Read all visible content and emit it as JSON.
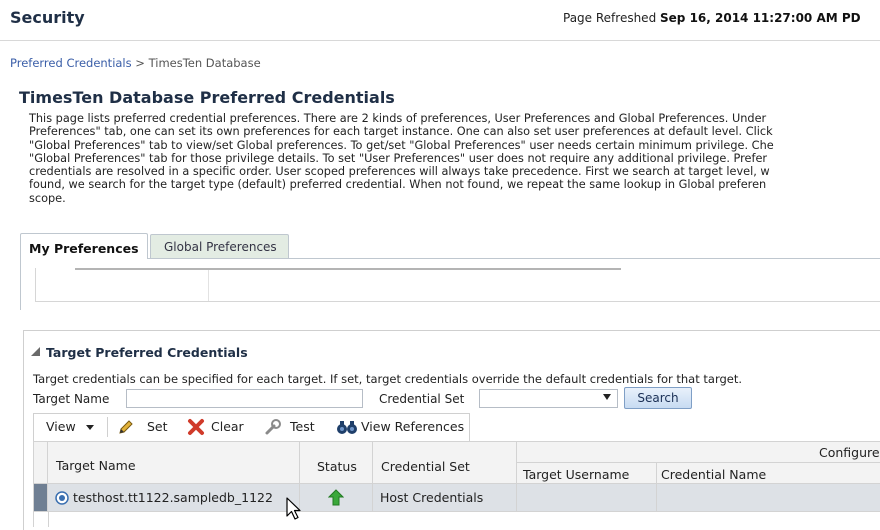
{
  "header": {
    "title": "Security",
    "refresh_prefix": "Page Refreshed",
    "refresh_time": "Sep 16, 2014 11:27:00 AM PD"
  },
  "breadcrumb": {
    "parent": "Preferred Credentials",
    "separator": ">",
    "current": "TimesTen Database"
  },
  "page": {
    "title": "TimesTen Database Preferred Credentials",
    "description_lines": [
      "This page lists preferred credential preferences. There are 2 kinds of preferences, User Preferences and Global Preferences. Under",
      "Preferences\" tab, one can set its own preferences for each target instance. One can also set user preferences at default level. Click",
      "\"Global Preferences\" tab to view/set Global preferences. To get/set \"Global Preferences\" user needs certain minimum privilege. Che",
      "\"Global Preferences\" tab for those privilege details. To set \"User Preferences\" user does not require any additional privilege. Prefer",
      "credentials are resolved in a specific order. User scoped preferences will always take precedence. First we search at target level, w",
      "found, we search for the target type (default) preferred credential. When not found, we repeat the same lookup in Global preferen",
      "scope."
    ]
  },
  "tabs": {
    "my": "My Preferences",
    "global": "Global Preferences"
  },
  "target_panel": {
    "title": "Target Preferred Credentials",
    "description": "Target credentials can be specified for each target. If set, target credentials override the default credentials for that target.",
    "target_name_label": "Target Name",
    "target_name_value": "",
    "credential_set_label": "Credential Set",
    "credential_set_value": "",
    "search_label": "Search"
  },
  "toolbar": {
    "view": "View",
    "set": "Set",
    "clear": "Clear",
    "test": "Test",
    "view_references": "View References"
  },
  "table": {
    "columns": {
      "target_name": "Target Name",
      "status": "Status",
      "credential_set": "Credential Set",
      "configured_group": "Configured",
      "target_username": "Target Username",
      "credential_name": "Credential Name"
    },
    "rows": [
      {
        "target_name": "testhost.tt1122.sampledb_1122",
        "status": "up",
        "credential_set": "Host Credentials",
        "target_username": "",
        "credential_name": ""
      }
    ]
  },
  "colors": {
    "title": "#1f2f46",
    "link": "#3a5ea8",
    "status_up": "#3aa83a",
    "clear_icon": "#d03a2a",
    "set_icon": "#d7a52a"
  }
}
